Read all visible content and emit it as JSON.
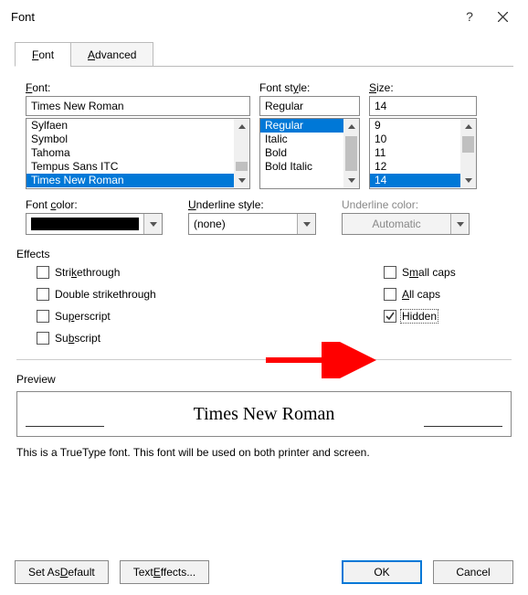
{
  "titlebar": {
    "title": "Font",
    "help_label": "?",
    "close_label": "✕"
  },
  "tabs": {
    "font": "Font",
    "advanced": "Advanced",
    "font_hk": "F",
    "advanced_hk": "A"
  },
  "font_section": {
    "label": "Font:",
    "label_hk": "F",
    "value": "Times New Roman",
    "items": [
      "Sylfaen",
      "Symbol",
      "Tahoma",
      "Tempus Sans ITC",
      "Times New Roman"
    ],
    "selected": "Times New Roman"
  },
  "style_section": {
    "label": "Font style:",
    "label_hk": "y",
    "value": "Regular",
    "items": [
      "Regular",
      "Italic",
      "Bold",
      "Bold Italic"
    ],
    "selected": "Regular"
  },
  "size_section": {
    "label": "Size:",
    "label_hk": "S",
    "value": "14",
    "items": [
      "9",
      "10",
      "11",
      "12",
      "14"
    ],
    "selected": "14"
  },
  "font_color": {
    "label": "Font color:",
    "label_hk": "c",
    "swatch": "#000000"
  },
  "underline_style": {
    "label": "Underline style:",
    "label_hk": "U",
    "value": "(none)"
  },
  "underline_color": {
    "label": "Underline color:",
    "value": "Automatic"
  },
  "effects_label": "Effects",
  "effects": {
    "strike": "Strikethrough",
    "strike_hk": "k",
    "dblstrike": "Double strikethrough",
    "super": "Superscript",
    "super_hk": "p",
    "sub": "Subscript",
    "sub_hk": "b",
    "smallcaps": "Small caps",
    "smallcaps_hk": "m",
    "allcaps": "All caps",
    "allcaps_hk": "A",
    "hidden": "Hidden",
    "hidden_checked": true
  },
  "preview": {
    "label": "Preview",
    "text": "Times New Roman",
    "note": "This is a TrueType font. This font will be used on both printer and screen."
  },
  "buttons": {
    "default": "Set As Default",
    "default_hk": "D",
    "texteffects": "Text Effects...",
    "texteffects_hk": "E",
    "ok": "OK",
    "cancel": "Cancel"
  }
}
